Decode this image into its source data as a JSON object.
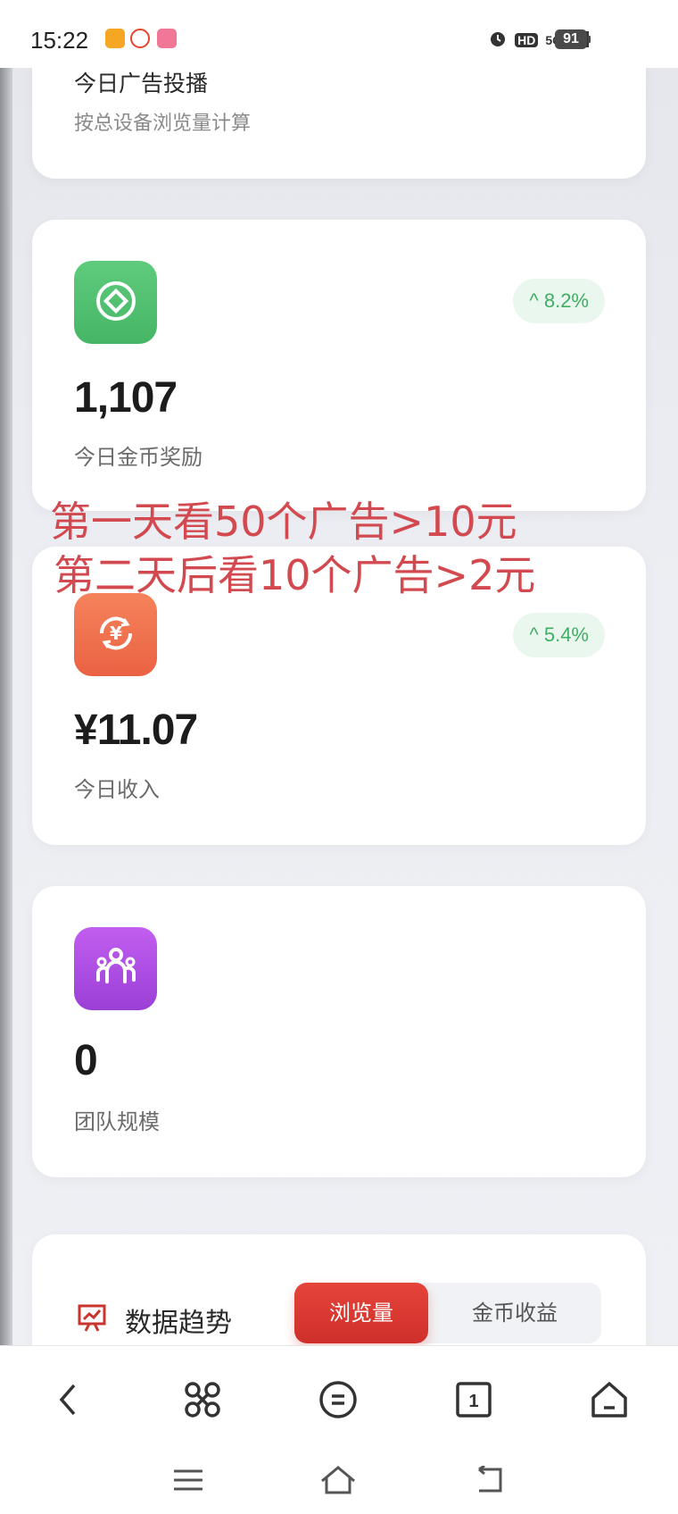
{
  "status_bar": {
    "time": "15:22",
    "network": "5G",
    "hd": "HD",
    "battery": "91"
  },
  "card_ad": {
    "title": "今日广告投播",
    "subtitle": "按总设备浏览量计算"
  },
  "card_coins": {
    "icon": "coin-icon",
    "value": "1,107",
    "label": "今日金币奖励",
    "change": "^ 8.2%",
    "accent": "#3fae63"
  },
  "card_income": {
    "icon": "yuan-exchange-icon",
    "value": "¥11.07",
    "label": "今日收入",
    "change": "^ 5.4%"
  },
  "card_team": {
    "icon": "team-icon",
    "value": "0",
    "label": "团队规模"
  },
  "overlay_text": {
    "line1": "第一天看50个广告>10元",
    "line2": "第二天后看10个广告>2元",
    "color": "#d24a4f"
  },
  "trend": {
    "title": "数据趋势",
    "tab_active": "浏览量",
    "tab_inactive": "金币收益"
  },
  "colors": {
    "green_icon": "#52c16f",
    "orange_icon": "#f0714e",
    "purple_icon": "#b24fe0",
    "active_tab": "#d93a31"
  }
}
